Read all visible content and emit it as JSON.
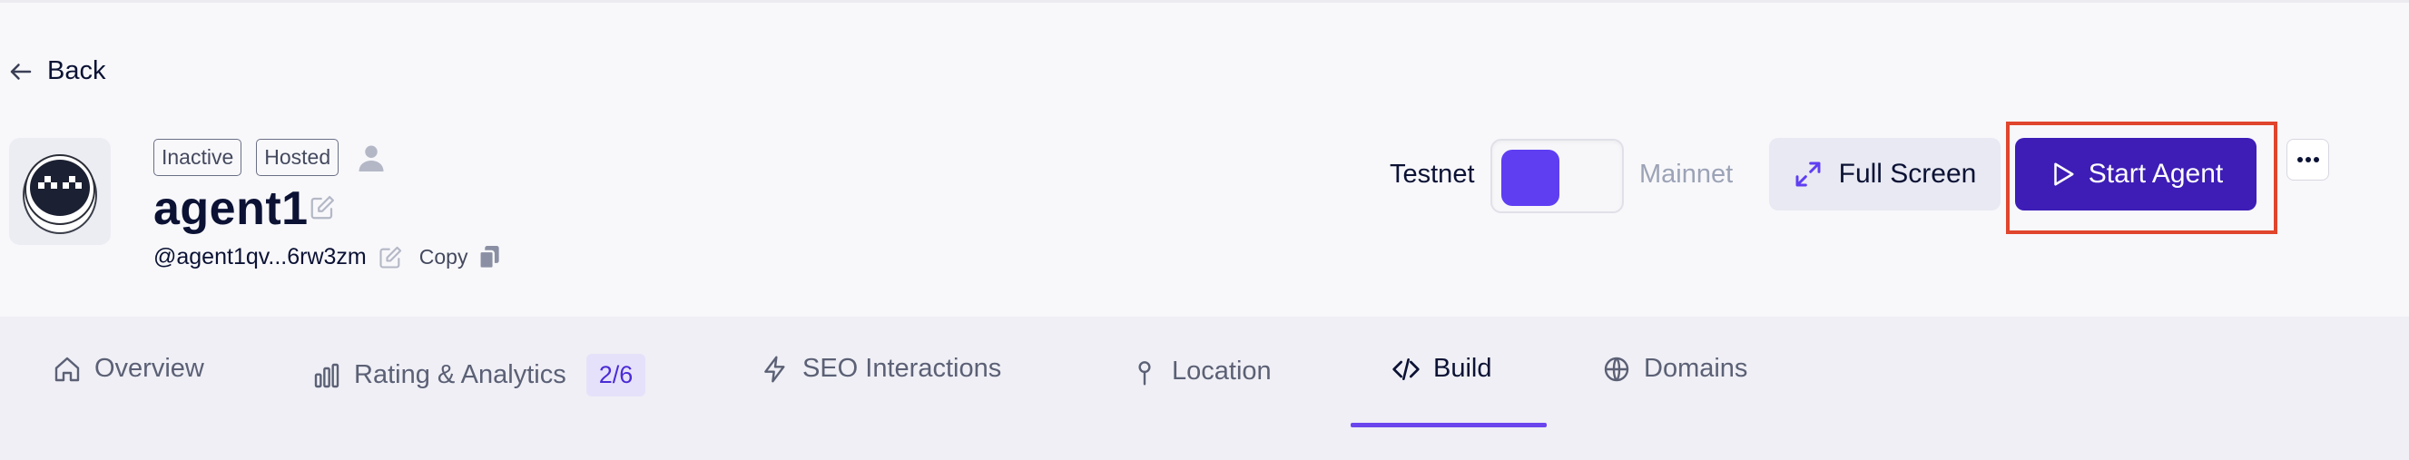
{
  "back": {
    "label": "Back"
  },
  "agent": {
    "status_badge": "Inactive",
    "hosting_badge": "Hosted",
    "name": "agent1",
    "address": "@agent1qv...6rw3zm",
    "copy_label": "Copy"
  },
  "network": {
    "left_label": "Testnet",
    "right_label": "Mainnet",
    "selected": "Testnet"
  },
  "actions": {
    "fullscreen_label": "Full Screen",
    "start_label": "Start Agent"
  },
  "tabs": [
    {
      "label": "Overview",
      "icon": "home-icon"
    },
    {
      "label": "Rating & Analytics",
      "icon": "bar-chart-icon",
      "count": "2/6"
    },
    {
      "label": "SEO Interactions",
      "icon": "lightning-icon"
    },
    {
      "label": "Location",
      "icon": "pin-icon"
    },
    {
      "label": "Build",
      "icon": "code-icon",
      "active": true
    },
    {
      "label": "Domains",
      "icon": "globe-icon"
    }
  ],
  "colors": {
    "accent": "#5f3ef2",
    "primary_button": "#3d1db6",
    "highlight_box": "#e0452d",
    "active_tab_underline": "#6a45ee"
  }
}
